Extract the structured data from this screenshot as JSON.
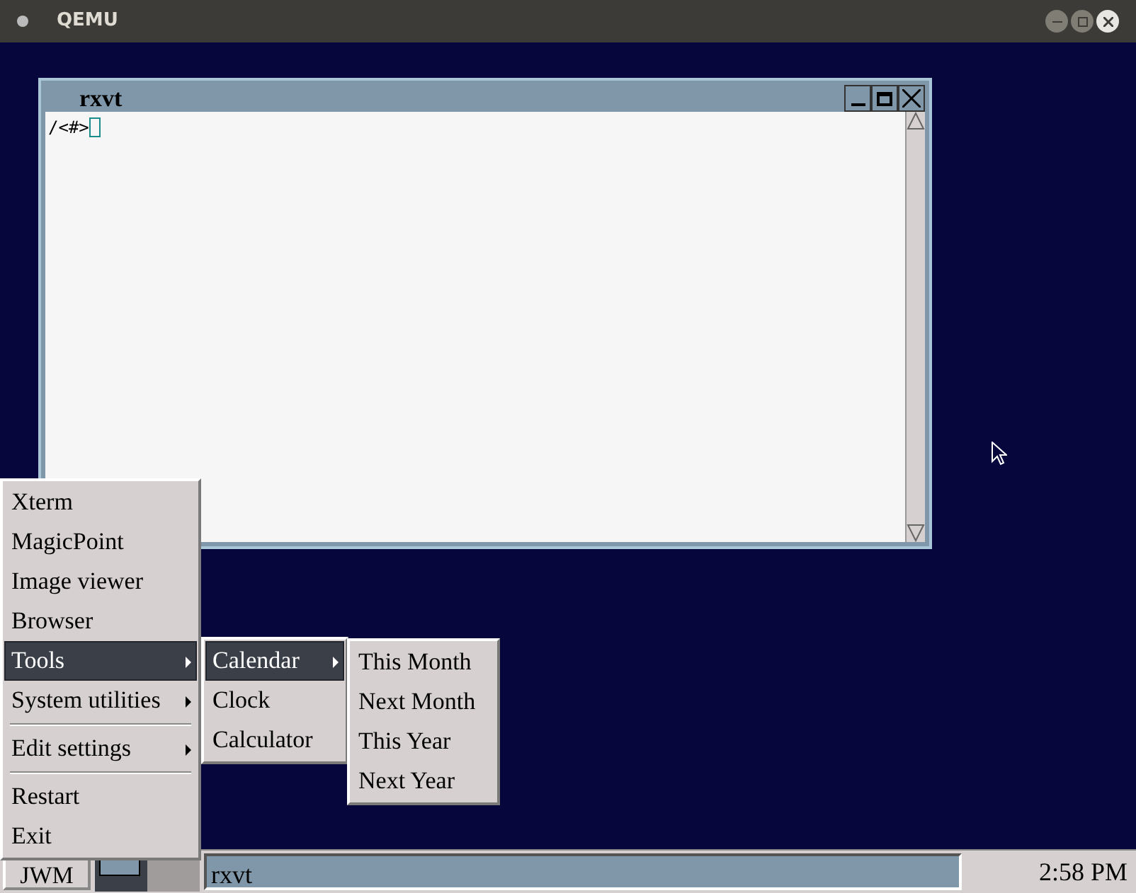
{
  "window": {
    "title": "QEMU"
  },
  "terminal": {
    "title": "rxvt",
    "prompt": "/<#>"
  },
  "menus": [
    {
      "items": [
        {
          "kind": "item",
          "label": "Xterm",
          "selected": false
        },
        {
          "kind": "item",
          "label": "MagicPoint",
          "selected": false
        },
        {
          "kind": "item",
          "label": "Image viewer",
          "selected": false
        },
        {
          "kind": "item",
          "label": "Browser",
          "selected": false
        },
        {
          "kind": "submenu",
          "label": "Tools",
          "selected": true
        },
        {
          "kind": "submenu",
          "label": "System utilities",
          "selected": false
        },
        {
          "kind": "separator"
        },
        {
          "kind": "submenu",
          "label": "Edit settings",
          "selected": false
        },
        {
          "kind": "separator"
        },
        {
          "kind": "item",
          "label": "Restart",
          "selected": false
        },
        {
          "kind": "item",
          "label": "Exit",
          "selected": false
        }
      ]
    },
    {
      "items": [
        {
          "kind": "submenu",
          "label": "Calendar",
          "selected": true
        },
        {
          "kind": "item",
          "label": "Clock",
          "selected": false
        },
        {
          "kind": "item",
          "label": "Calculator",
          "selected": false
        }
      ]
    },
    {
      "items": [
        {
          "kind": "item",
          "label": "This Month",
          "selected": false
        },
        {
          "kind": "item",
          "label": "Next Month",
          "selected": false
        },
        {
          "kind": "item",
          "label": "This Year",
          "selected": false
        },
        {
          "kind": "item",
          "label": "Next Year",
          "selected": false
        }
      ]
    }
  ],
  "taskbar": {
    "start_button": "JWM",
    "desktops": [
      {
        "selected": true
      },
      {
        "selected": false
      }
    ],
    "tasks": [
      {
        "label": "rxvt",
        "selected": true
      }
    ],
    "clock": "2:58 PM"
  }
}
